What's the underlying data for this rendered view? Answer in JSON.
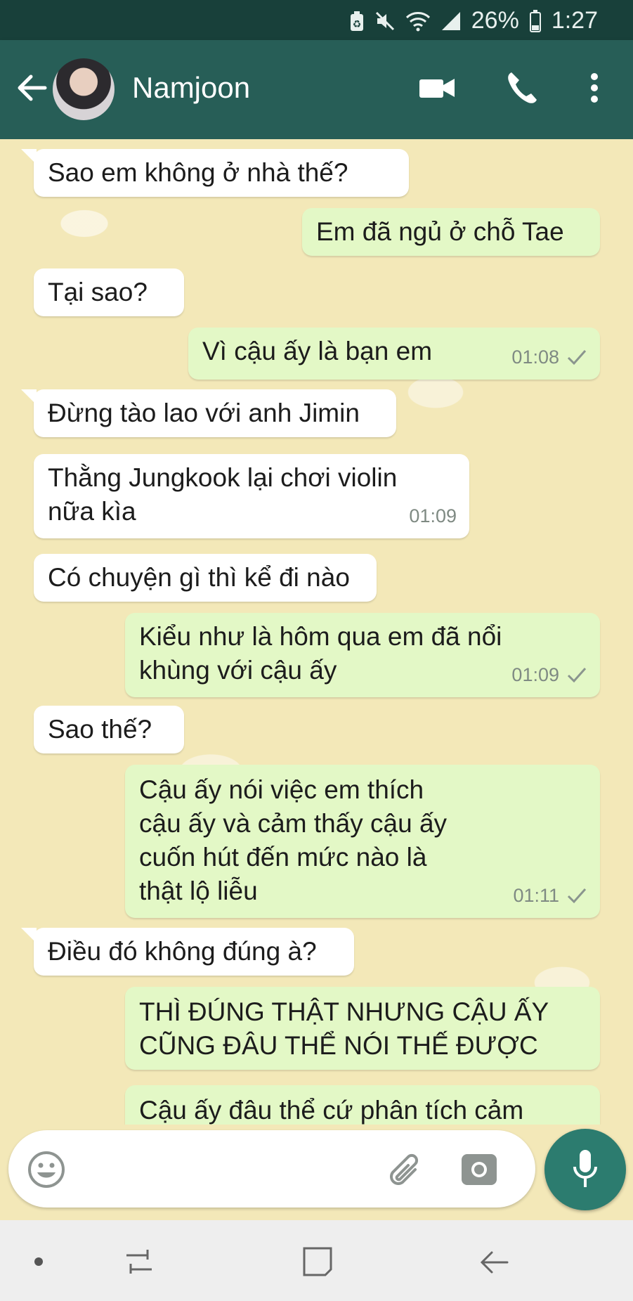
{
  "status": {
    "battery": "26%",
    "time": "1:27"
  },
  "header": {
    "contact_name": "Namjoon"
  },
  "messages": [
    {
      "dir": "in",
      "text": "Sao em không ở nhà thế?",
      "time": ""
    },
    {
      "dir": "out",
      "text": "Em đã ngủ ở chỗ Tae",
      "time": ""
    },
    {
      "dir": "in",
      "text": "Tại sao?",
      "time": ""
    },
    {
      "dir": "out",
      "text": "Vì cậu ấy là bạn em",
      "time": "01:08"
    },
    {
      "dir": "in",
      "text": "Đừng tào lao với anh Jimin",
      "time": ""
    },
    {
      "dir": "in",
      "text": "Thằng Jungkook lại chơi violin\nnữa kìa",
      "time": "01:09"
    },
    {
      "dir": "in",
      "text": "Có chuyện gì thì kể đi nào",
      "time": ""
    },
    {
      "dir": "out",
      "text": "Kiểu như là hôm qua em đã nổi\nkhùng với cậu ấy",
      "time": "01:09"
    },
    {
      "dir": "in",
      "text": "Sao thế?",
      "time": ""
    },
    {
      "dir": "out",
      "text": "Cậu ấy nói việc em thích\ncậu ấy và cảm thấy cậu ấy\ncuốn hút đến mức nào là\nthật lộ liễu",
      "time": "01:11"
    },
    {
      "dir": "in",
      "text": "Điều đó không đúng à?",
      "time": ""
    },
    {
      "dir": "out",
      "text": "THÌ ĐÚNG THẬT NHƯNG CẬU ẤY\nCŨNG ĐÂU THỂ NÓI THẾ ĐƯỢC",
      "time": ""
    },
    {
      "dir": "out",
      "text": "Cậu ấy đâu thể cứ phân tích cảm",
      "time": ""
    }
  ],
  "icons": {
    "back": "arrow-left-icon",
    "video": "video-camera-icon",
    "call": "phone-icon",
    "menu": "more-vert-icon",
    "emoji": "emoji-icon",
    "attach": "paperclip-icon",
    "camera": "camera-icon",
    "mic": "mic-icon"
  },
  "colors": {
    "appbar": "#275e57",
    "statusbar": "#18403a",
    "outgoing": "#e3f8c6",
    "incoming": "#ffffff",
    "mic_button": "#2c7c6f",
    "chat_bg": "#f3e8b8"
  }
}
